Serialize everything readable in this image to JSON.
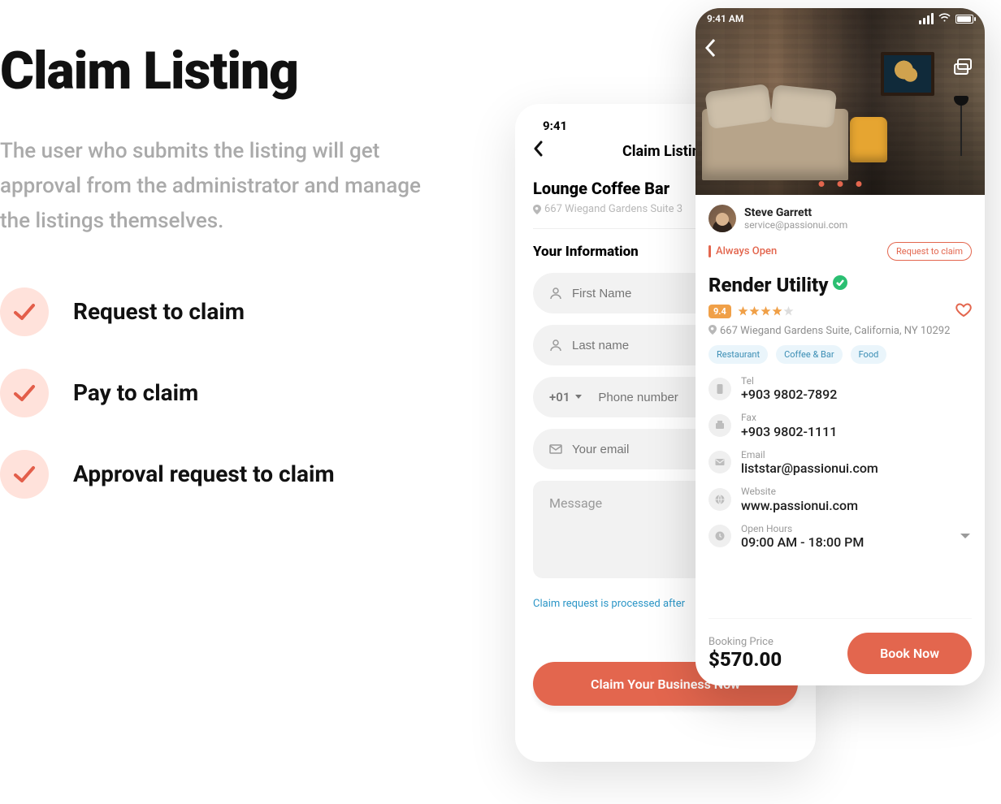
{
  "left": {
    "title": "Claim Listing",
    "desc": "The user who submits the listing will get approval from the administrator and manage the listings themselves.",
    "features": [
      "Request to claim",
      "Pay to claim",
      "Approval request to claim"
    ]
  },
  "phone1": {
    "status_time": "9:41",
    "nav_title": "Claim Listing",
    "listing_name": "Lounge Coffee Bar",
    "listing_address": "667 Wiegand Gardens Suite 3",
    "section_label": "Your Information",
    "placeholders": {
      "first_name": "First Name",
      "last_name": "Last name",
      "phone_prefix": "+01",
      "phone": "Phone number",
      "email": "Your email",
      "message": "Message"
    },
    "note": "Claim request is processed after",
    "cta": "Claim Your Business Now"
  },
  "phone2": {
    "status_time": "9:41 AM",
    "owner": {
      "name": "Steve Garrett",
      "email": "service@passionui.com"
    },
    "open_text": "Always Open",
    "claim_button": "Request to claim",
    "biz_title": "Render Utility",
    "rating": "9.4",
    "address": "667 Wiegand Gardens Suite, California, NY 10292",
    "tags": [
      "Restaurant",
      "Coffee & Bar",
      "Food"
    ],
    "info": {
      "tel": {
        "label": "Tel",
        "value": "+903 9802-7892"
      },
      "fax": {
        "label": "Fax",
        "value": "+903 9802-1111"
      },
      "email": {
        "label": "Email",
        "value": "liststar@passionui.com"
      },
      "web": {
        "label": "Website",
        "value": "www.passionui.com"
      },
      "hours": {
        "label": "Open Hours",
        "value": "09:00 AM - 18:00 PM"
      }
    },
    "price": {
      "label": "Booking Price",
      "value": "$570.00"
    },
    "book_btn": "Book Now"
  }
}
